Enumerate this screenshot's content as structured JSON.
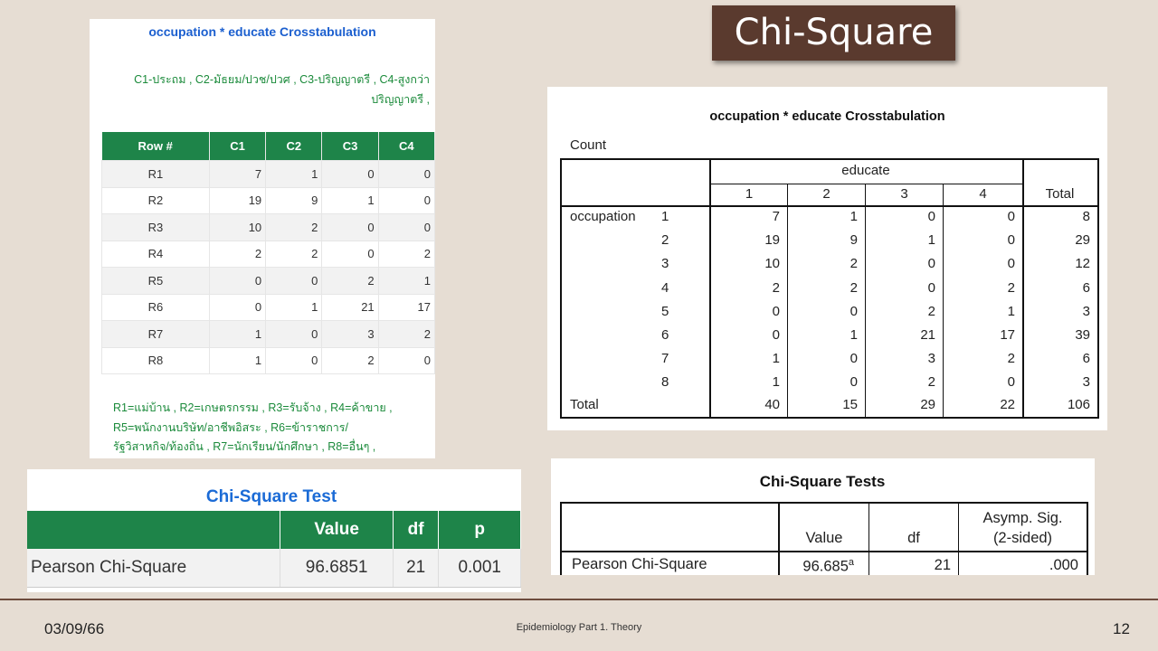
{
  "slide": {
    "title": "Chi-Square",
    "footer": {
      "date": "03/09/66",
      "center": "Epidemiology Part 1. Theory",
      "page_number": "12"
    },
    "colors": {
      "background": "#e6ddd3",
      "title_box": "#5a3a2e",
      "table_header_green": "#1e8449",
      "title_blue": "#1b5fcf",
      "legend_green": "#1a8a3a"
    }
  },
  "web_crosstab": {
    "title": "occupation * educate Crosstabulation",
    "legend_line1": "C1-ประถม , C2-มัธยม/ปวช/ปวศ , C3-ปริญญาตรี , C4-สูงกว่า",
    "legend_line2": "ปริญญาตรี ,",
    "headers": [
      "Row #",
      "C1",
      "C2",
      "C3",
      "C4"
    ],
    "rows": [
      [
        "R1",
        "7",
        "1",
        "0",
        "0"
      ],
      [
        "R2",
        "19",
        "9",
        "1",
        "0"
      ],
      [
        "R3",
        "10",
        "2",
        "0",
        "0"
      ],
      [
        "R4",
        "2",
        "2",
        "0",
        "2"
      ],
      [
        "R5",
        "0",
        "0",
        "2",
        "1"
      ],
      [
        "R6",
        "0",
        "1",
        "21",
        "17"
      ],
      [
        "R7",
        "1",
        "0",
        "3",
        "2"
      ],
      [
        "R8",
        "1",
        "0",
        "2",
        "0"
      ]
    ],
    "row_legend_line1": "R1=แม่บ้าน , R2=เกษตรกรรม , R3=รับจ้าง , R4=ค้าขาย ,",
    "row_legend_line2": "R5=พนักงานบริษัท/อาชีพอิสระ , R6=ข้าราชการ/",
    "row_legend_line3": "รัฐวิสาหกิจ/ท้องถิ่น , R7=นักเรียน/นักศึกษา , R8=อื่นๆ ,"
  },
  "web_chi_test": {
    "title": "Chi-Square Test",
    "headers": [
      "",
      "Value",
      "df",
      "p"
    ],
    "row": [
      "Pearson Chi-Square",
      "96.6851",
      "21",
      "0.001"
    ]
  },
  "spss_crosstab": {
    "title": "occupation * educate Crosstabulation",
    "count_label": "Count",
    "educate_label": "educate",
    "col_headers": [
      "1",
      "2",
      "3",
      "4"
    ],
    "total_label": "Total",
    "occupation_label": "occupation",
    "row_labels": [
      "1",
      "2",
      "3",
      "4",
      "5",
      "6",
      "7",
      "8"
    ],
    "rows": [
      [
        "7",
        "1",
        "0",
        "0",
        "8"
      ],
      [
        "19",
        "9",
        "1",
        "0",
        "29"
      ],
      [
        "10",
        "2",
        "0",
        "0",
        "12"
      ],
      [
        "2",
        "2",
        "0",
        "2",
        "6"
      ],
      [
        "0",
        "0",
        "2",
        "1",
        "3"
      ],
      [
        "0",
        "1",
        "21",
        "17",
        "39"
      ],
      [
        "1",
        "0",
        "3",
        "2",
        "6"
      ],
      [
        "1",
        "0",
        "2",
        "0",
        "3"
      ]
    ],
    "total_row_label": "Total",
    "total_row": [
      "40",
      "15",
      "29",
      "22",
      "106"
    ]
  },
  "spss_chi_tests": {
    "title": "Chi-Square Tests",
    "col_value": "Value",
    "col_df": "df",
    "col_sig_line1": "Asymp. Sig.",
    "col_sig_line2": "(2-sided)",
    "row_label": "Pearson Chi-Square",
    "value": "96.685",
    "value_superscript": "a",
    "df": "21",
    "sig": ".000"
  }
}
